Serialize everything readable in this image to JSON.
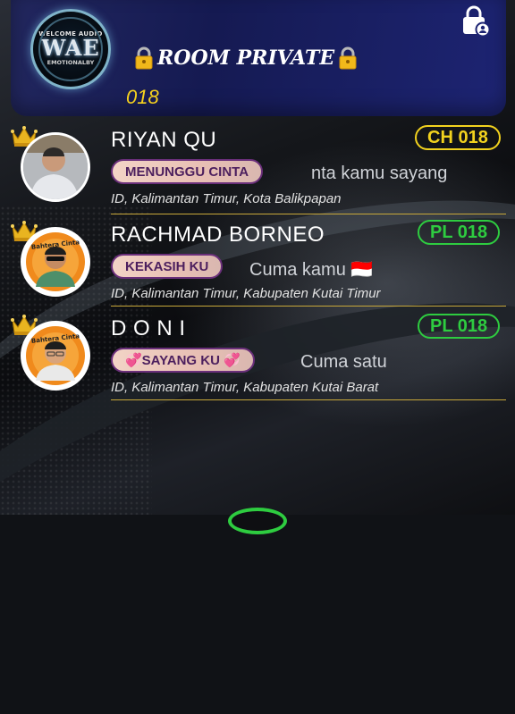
{
  "header": {
    "logo_top": "WELCOME AUDIO",
    "logo_main": "WAE",
    "logo_bottom": "EMOTIONALBY",
    "title": "ROOM PRIVATE",
    "room_code": "018",
    "lock_icon": "lock-person-icon"
  },
  "users": [
    {
      "name": "RIYAN QU",
      "badge": "CH 018",
      "badge_color": "#f2d21e",
      "status": "MENUNGGU CINTA",
      "message": "nta kamu sayang",
      "location": "ID, Kalimantan Timur, Kota Balikpapan"
    },
    {
      "name": "RACHMAD BORNEO",
      "badge": "PL 018",
      "badge_color": "#2ecc40",
      "avatar_text": "Bahtera Cinta",
      "status": "KEKASIH KU",
      "message": "Cuma kamu 🇮🇩",
      "location": "ID, Kalimantan Timur, Kabupaten Kutai Timur"
    },
    {
      "name": "D O N I",
      "badge": "PL 018",
      "badge_color": "#2ecc40",
      "avatar_text": "Bahtera Cinta",
      "status": "💞SAYANG KU 💞",
      "message": "Cuma satu",
      "location": "ID, Kalimantan Timur, Kabupaten Kutai Barat"
    }
  ],
  "colors": {
    "accent_yellow": "#f6d21e",
    "accent_green": "#2ecc40",
    "header_blue": "#1d2473"
  }
}
